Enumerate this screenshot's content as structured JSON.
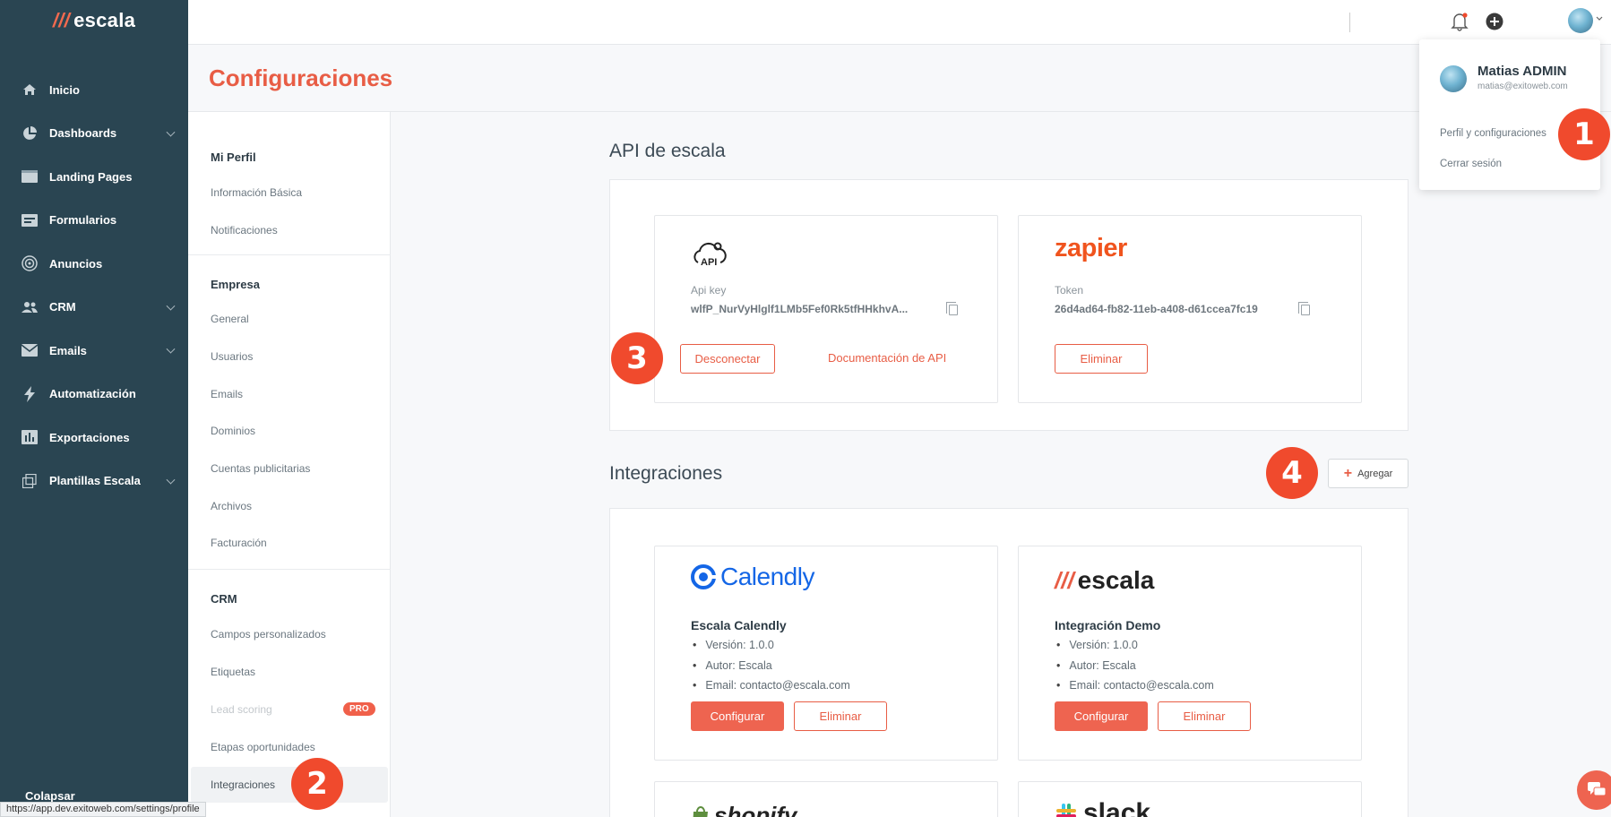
{
  "app": {
    "brand": "escala"
  },
  "sidebar": {
    "items": [
      {
        "label": "Inicio",
        "icon": "home-icon",
        "has_chevron": false
      },
      {
        "label": "Dashboards",
        "icon": "pie-chart-icon",
        "has_chevron": true
      },
      {
        "label": "Landing Pages",
        "icon": "browser-icon",
        "has_chevron": false
      },
      {
        "label": "Formularios",
        "icon": "form-icon",
        "has_chevron": false
      },
      {
        "label": "Anuncios",
        "icon": "target-icon",
        "has_chevron": false
      },
      {
        "label": "CRM",
        "icon": "users-icon",
        "has_chevron": true
      },
      {
        "label": "Emails",
        "icon": "envelope-icon",
        "has_chevron": true
      },
      {
        "label": "Automatización",
        "icon": "lightning-icon",
        "has_chevron": false
      },
      {
        "label": "Exportaciones",
        "icon": "chart-box-icon",
        "has_chevron": false
      },
      {
        "label": "Plantillas Escala",
        "icon": "copy-icon",
        "has_chevron": true
      }
    ],
    "collapse_label": "Colapsar"
  },
  "header": {
    "title": "Configuraciones"
  },
  "settings_menu": {
    "sections": [
      {
        "title": "Mi Perfil",
        "items": [
          "Información Básica",
          "Notificaciones"
        ]
      },
      {
        "title": "Empresa",
        "items": [
          "General",
          "Usuarios",
          "Emails",
          "Dominios",
          "Cuentas publicitarias",
          "Archivos",
          "Facturación"
        ]
      },
      {
        "title": "CRM",
        "items": [
          "Campos personalizados",
          "Etiquetas",
          "Lead scoring",
          "Etapas oportunidades",
          "Integraciones"
        ]
      }
    ],
    "pro_badge": "PRO",
    "active_item": "Integraciones"
  },
  "api_section": {
    "title": "API de escala",
    "api_card": {
      "logo_text": "API",
      "label": "Api key",
      "value": "wlfP_NurVyHlglf1LMb5Fef0Rk5tfHHkhvA...",
      "disconnect_label": "Desconectar",
      "docs_label": "Documentación de API"
    },
    "zapier_card": {
      "logo_text": "zapier",
      "label": "Token",
      "value": "26d4ad64-fb82-11eb-a408-d61ccea7fc19",
      "delete_label": "Eliminar"
    }
  },
  "integrations": {
    "title": "Integraciones",
    "add_label": "Agregar",
    "cards": [
      {
        "logo_text": "Calendly",
        "name": "Escala Calendly",
        "details": [
          "Versión: 1.0.0",
          "Autor: Escala",
          "Email: contacto@escala.com"
        ],
        "configure_label": "Configurar",
        "delete_label": "Eliminar"
      },
      {
        "logo_text": "escala",
        "name": "Integración Demo",
        "details": [
          "Versión: 1.0.0",
          "Autor: Escala",
          "Email: contacto@escala.com"
        ],
        "configure_label": "Configurar",
        "delete_label": "Eliminar"
      }
    ],
    "partial_cards": [
      "shopify",
      "slack"
    ]
  },
  "user_menu": {
    "name": "Matias ADMIN",
    "email": "matias@exitoweb.com",
    "items": [
      "Perfil y configuraciones",
      "Cerrar sesión"
    ]
  },
  "step_badges": [
    "1",
    "2",
    "3",
    "4"
  ],
  "status_url": "https://app.dev.exitoweb.com/settings/profile",
  "colors": {
    "brand": "#e85d45",
    "sidebar": "#2a4552",
    "badge": "#f04a2d"
  }
}
